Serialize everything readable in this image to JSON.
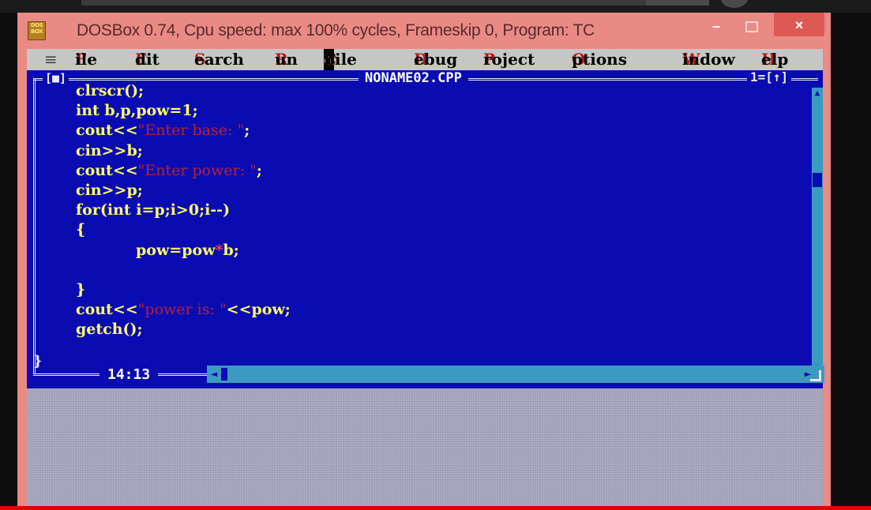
{
  "window": {
    "title": "DOSBox 0.74, Cpu speed: max 100% cycles, Frameskip  0, Program:      TC",
    "icon_label": "DOS BOX",
    "controls": [
      "minimize",
      "maximize",
      "close"
    ],
    "close_glyph": "×",
    "minimize_glyph": "–"
  },
  "menu": {
    "system": "≡",
    "items": [
      {
        "hotkey": "F",
        "rest": "ile"
      },
      {
        "hotkey": "E",
        "rest": "dit"
      },
      {
        "hotkey": "S",
        "rest": "earch"
      },
      {
        "hotkey": "R",
        "rest": "un"
      },
      {
        "pre": "C",
        "cursor": "o",
        "hotkey": "m",
        "rest": "pile"
      },
      {
        "hotkey": "D",
        "rest": "ebug"
      },
      {
        "hotkey": "P",
        "rest": "roject"
      },
      {
        "hotkey": "O",
        "rest": "ptions"
      },
      {
        "hotkey": "W",
        "rest": "indow"
      },
      {
        "hotkey": "H",
        "rest": "elp"
      }
    ]
  },
  "editor": {
    "close_box": "[■]",
    "filename": "NONAME02.CPP",
    "window_number": "1=[↑]",
    "position": "14:13",
    "code_lines": [
      {
        "text": "clrscr();"
      },
      {
        "text": "int b,p,pow=1;"
      },
      {
        "pre": "cout<<",
        "str": "\"Enter base: \"",
        "post": ";"
      },
      {
        "text": "cin>>b;"
      },
      {
        "pre": "cout<<",
        "str": "\"Enter power: \"",
        "post": ";"
      },
      {
        "text": "cin>>p;"
      },
      {
        "text": "for(int i=p;i>0;i--)"
      },
      {
        "text": "{"
      },
      {
        "indented": true,
        "pre": "pow=pow",
        "op": "*",
        "post": "b;"
      },
      {
        "text": ""
      },
      {
        "text": "}"
      },
      {
        "pre": "cout<<",
        "str": "\"power is: \"",
        "post": "<<pow;"
      },
      {
        "text": "getch();"
      }
    ],
    "closing_brace": "}"
  },
  "colors": {
    "frame": "#e98a84",
    "editor_bg": "#0b0bb2",
    "code_text": "#ffff6a",
    "string_text": "#cc2828",
    "menu_bg": "#c6c6c6",
    "menu_hotkey": "#b01818"
  }
}
